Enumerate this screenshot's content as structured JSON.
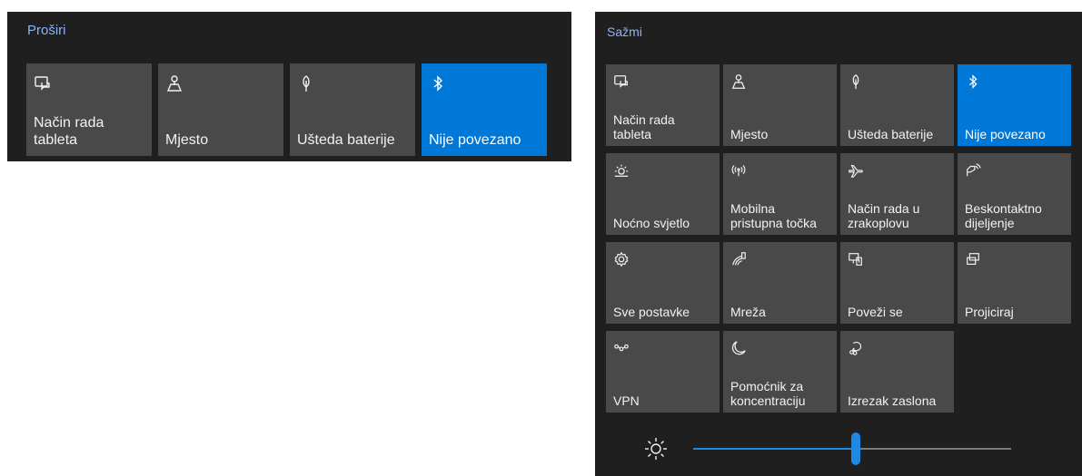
{
  "collapsed": {
    "toggle_label": "Proširi",
    "tiles": [
      {
        "label": "Način rada\ntableta",
        "icon": "tablet-mode-icon",
        "active": false
      },
      {
        "label": "Mjesto",
        "icon": "location-icon",
        "active": false
      },
      {
        "label": "Ušteda baterije",
        "icon": "battery-saver-icon",
        "active": false
      },
      {
        "label": "Nije povezano",
        "icon": "bluetooth-icon",
        "active": true
      }
    ]
  },
  "expanded": {
    "toggle_label": "Sažmi",
    "tiles": [
      {
        "label": "Način rada\ntableta",
        "icon": "tablet-mode-icon",
        "active": false
      },
      {
        "label": "Mjesto",
        "icon": "location-icon",
        "active": false
      },
      {
        "label": "Ušteda baterije",
        "icon": "battery-saver-icon",
        "active": false
      },
      {
        "label": "Nije povezano",
        "icon": "bluetooth-icon",
        "active": true
      },
      {
        "label": "Noćno svjetlo",
        "icon": "night-light-icon",
        "active": false
      },
      {
        "label": "Mobilna\npristupna točka",
        "icon": "mobile-hotspot-icon",
        "active": false
      },
      {
        "label": "Način rada u\nzrakoplovu",
        "icon": "airplane-mode-icon",
        "active": false
      },
      {
        "label": "Beskontaktno\ndijeljenje",
        "icon": "nearby-sharing-icon",
        "active": false
      },
      {
        "label": "Sve postavke",
        "icon": "settings-gear-icon",
        "active": false
      },
      {
        "label": "Mreža",
        "icon": "network-icon",
        "active": false
      },
      {
        "label": "Poveži se",
        "icon": "connect-icon",
        "active": false
      },
      {
        "label": "Projiciraj",
        "icon": "project-icon",
        "active": false
      },
      {
        "label": "VPN",
        "icon": "vpn-icon",
        "active": false
      },
      {
        "label": "Pomoćnik za\nkoncentraciju",
        "icon": "focus-assist-moon-icon",
        "active": false
      },
      {
        "label": "Izrezak zaslona",
        "icon": "screen-snip-icon",
        "active": false
      }
    ],
    "brightness": {
      "icon": "brightness-sun-icon",
      "value_fraction": 0.51
    }
  },
  "colors": {
    "panel": "#1f1f1f",
    "tile": "#494949",
    "accent": "#0078d7",
    "link": "#8ab4f8"
  }
}
